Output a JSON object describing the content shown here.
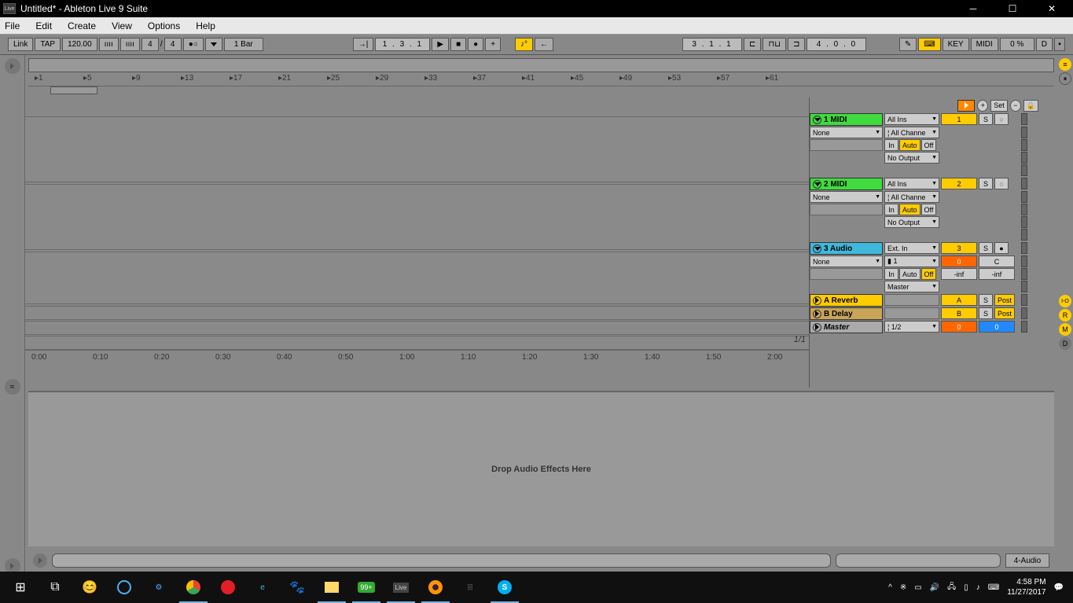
{
  "window": {
    "title": "Untitled* - Ableton Live 9 Suite",
    "icon": "Live"
  },
  "menubar": [
    "File",
    "Edit",
    "Create",
    "View",
    "Options",
    "Help"
  ],
  "toolbar": {
    "link": "Link",
    "tap": "TAP",
    "tempo": "120.00",
    "sig_num": "4",
    "sig_den": "4",
    "metronome": "●",
    "quantize": "1 Bar",
    "position": "1 .  3 .  1",
    "loop_pos": "3 .  1 .  1",
    "loop_len": "4 .  0 .  0",
    "key": "KEY",
    "midi": "MIDI",
    "cpu": "0 %",
    "overload": "D"
  },
  "ruler_bars": [
    1,
    5,
    9,
    13,
    17,
    21,
    25,
    29,
    33,
    37,
    41,
    45,
    49,
    53,
    57,
    61
  ],
  "ruler_time": [
    "0:00",
    "0:10",
    "0:20",
    "0:30",
    "0:40",
    "0:50",
    "1:00",
    "1:10",
    "1:20",
    "1:30",
    "1:40",
    "1:50",
    "2:00"
  ],
  "panel_header": {
    "set": "Set"
  },
  "tracks": [
    {
      "name": "1 MIDI",
      "color": "t-green",
      "device": "None",
      "input_type": "All Ins",
      "input_ch": "¦ All Channe",
      "monitor": {
        "in": "In",
        "auto": "Auto",
        "off": "Off",
        "active": "auto"
      },
      "output": "No Output",
      "mix_num": "1",
      "solo": "S",
      "arm": "○"
    },
    {
      "name": "2 MIDI",
      "color": "t-green",
      "device": "None",
      "input_type": "All Ins",
      "input_ch": "¦ All Channe",
      "monitor": {
        "in": "In",
        "auto": "Auto",
        "off": "Off",
        "active": "auto"
      },
      "output": "No Output",
      "mix_num": "2",
      "solo": "S",
      "arm": "○"
    },
    {
      "name": "3 Audio",
      "color": "t-cyan",
      "device": "None",
      "input_type": "Ext. In",
      "input_ch": "▮ 1",
      "monitor": {
        "in": "In",
        "auto": "Auto",
        "off": "Off",
        "active": "off"
      },
      "output": "Master",
      "mix_num": "3",
      "solo": "S",
      "arm": "●",
      "send_a": "0",
      "send_b": "C",
      "vol_l": "-inf",
      "vol_r": "-inf"
    }
  ],
  "returns": [
    {
      "name": "A Reverb",
      "color": "t-yellow",
      "mix": "A",
      "solo": "S",
      "post": "Post"
    },
    {
      "name": "B Delay",
      "color": "t-tan",
      "mix": "B",
      "solo": "S",
      "post": "Post"
    }
  ],
  "master": {
    "name": "Master",
    "color": "t-grey",
    "cue": "¦ 1/2",
    "send_a": "0",
    "send_b": "0"
  },
  "zoom": "1/1",
  "effects": {
    "drop_text": "Drop Audio Effects Here"
  },
  "bottom": {
    "selected": "4-Audio"
  },
  "taskbar": {
    "time": "4:58 PM",
    "date": "11/27/2017",
    "badge": "99+"
  }
}
